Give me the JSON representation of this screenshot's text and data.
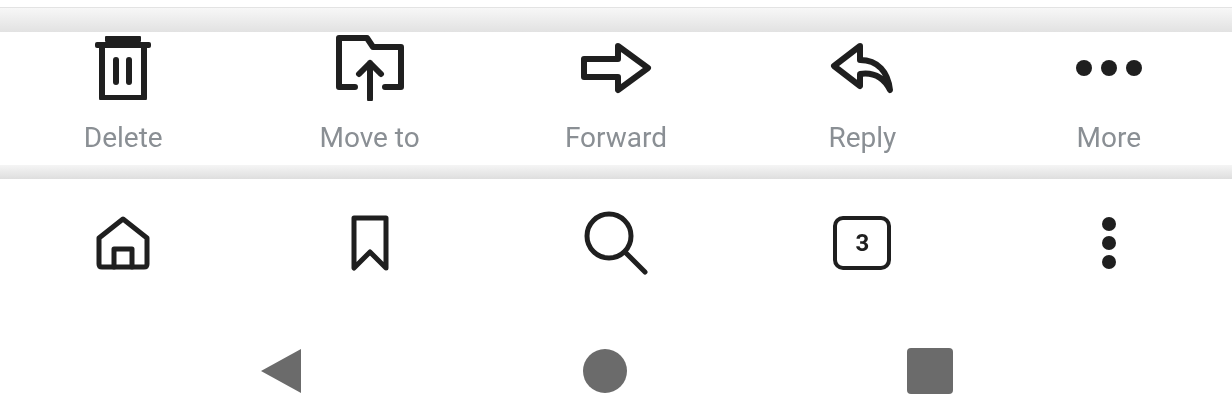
{
  "action_bar": [
    {
      "kind": "delete",
      "label": "Delete"
    },
    {
      "kind": "move",
      "label": "Move to"
    },
    {
      "kind": "forward",
      "label": "Forward"
    },
    {
      "kind": "reply",
      "label": "Reply"
    },
    {
      "kind": "more",
      "label": "More"
    }
  ],
  "browser_toolbar": [
    {
      "kind": "home"
    },
    {
      "kind": "bookmark"
    },
    {
      "kind": "search"
    },
    {
      "kind": "tabs",
      "count": "3"
    },
    {
      "kind": "menu"
    }
  ],
  "nav_bar": [
    {
      "kind": "back"
    },
    {
      "kind": "home"
    },
    {
      "kind": "recents"
    }
  ]
}
